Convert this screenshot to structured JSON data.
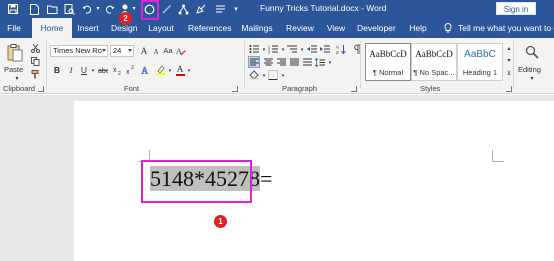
{
  "title_bar": {
    "document_title": "Funny Tricks Tutorial.docx - Word",
    "sign_in_label": "Sign in",
    "qat_icons": [
      "save-icon",
      "new-document-icon",
      "open-folder-icon",
      "print-preview-icon",
      "undo-icon",
      "touch-mode-icon",
      "redo-icon",
      "read-aloud-icon",
      "circle-shape-icon",
      "pen-icon",
      "draw-icon",
      "network-icon",
      "text-direction-icon",
      "customize-qat-icon"
    ]
  },
  "tabs": [
    {
      "label": "File"
    },
    {
      "label": "Home"
    },
    {
      "label": "Insert"
    },
    {
      "label": "Design"
    },
    {
      "label": "Layout"
    },
    {
      "label": "References"
    },
    {
      "label": "Mailings"
    },
    {
      "label": "Review"
    },
    {
      "label": "View"
    },
    {
      "label": "Developer"
    },
    {
      "label": "Help"
    }
  ],
  "active_tab": "Home",
  "tell_me": "Tell me what you want to do",
  "ribbon": {
    "clipboard": {
      "label": "Clipboard",
      "paste_label": "Paste"
    },
    "font": {
      "label": "Font",
      "font_name": "Times New Ro",
      "font_size": "24",
      "bold": "B",
      "italic": "I",
      "underline": "U",
      "font_color_letter": "A",
      "highlight_letter": "A",
      "clear_format": "Aa",
      "grow_font": "A",
      "shrink_font": "A"
    },
    "paragraph": {
      "label": "Paragraph"
    },
    "styles": {
      "label": "Styles",
      "items": [
        {
          "preview": "AaBbCcD",
          "name": "¶ Normal"
        },
        {
          "preview": "AaBbCcD",
          "name": "¶ No Spac..."
        },
        {
          "preview": "AaBbC",
          "name": "Heading 1"
        }
      ]
    },
    "editing": {
      "label": "Editing"
    }
  },
  "document": {
    "text_selected": "5148*45278",
    "text_after": "="
  },
  "annotations": {
    "badge_1": "1",
    "badge_2": "2"
  },
  "colors": {
    "word_blue": "#2b579a",
    "highlight": "#e020e0",
    "badge_red": "#e62020",
    "font_color_red": "#e00000",
    "highlight_yellow": "#ffff00"
  }
}
